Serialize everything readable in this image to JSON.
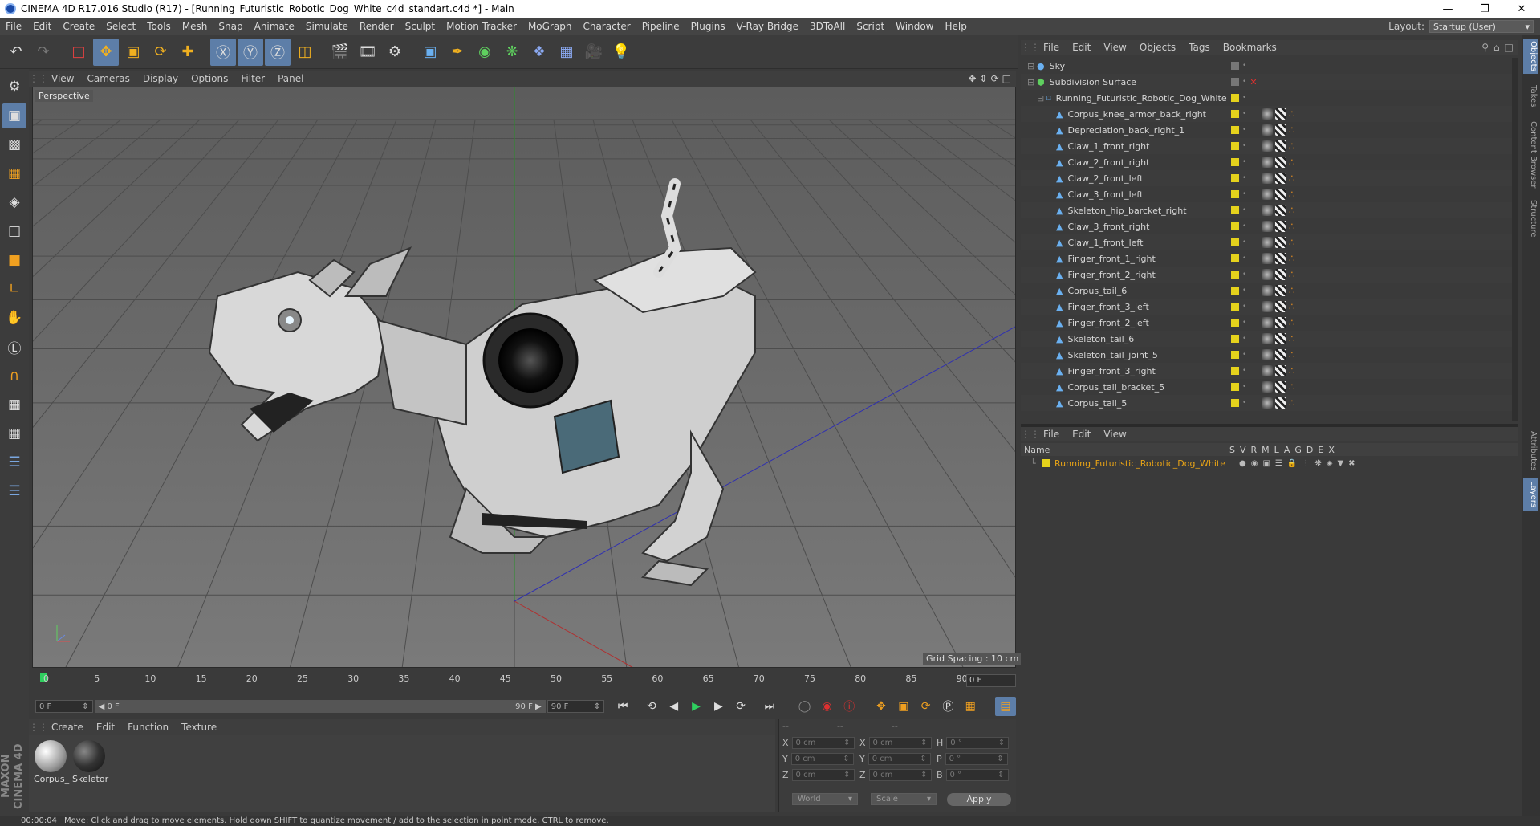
{
  "title": "CINEMA 4D R17.016 Studio (R17) - [Running_Futuristic_Robotic_Dog_White_c4d_standart.c4d *] - Main",
  "menu": [
    "File",
    "Edit",
    "Create",
    "Select",
    "Tools",
    "Mesh",
    "Snap",
    "Animate",
    "Simulate",
    "Render",
    "Sculpt",
    "Motion Tracker",
    "MoGraph",
    "Character",
    "Pipeline",
    "Plugins",
    "V-Ray Bridge",
    "3DToAll",
    "Script",
    "Window",
    "Help"
  ],
  "layout_label": "Layout:",
  "layout_value": "Startup (User)",
  "viewport_menu": [
    "View",
    "Cameras",
    "Display",
    "Options",
    "Filter",
    "Panel"
  ],
  "viewport_label": "Perspective",
  "grid_spacing": "Grid Spacing : 10 cm",
  "timeline_ticks": [
    "0",
    "5",
    "10",
    "15",
    "20",
    "25",
    "30",
    "35",
    "40",
    "45",
    "50",
    "55",
    "60",
    "65",
    "70",
    "75",
    "80",
    "85",
    "90"
  ],
  "current_frame": "0 F",
  "transport": {
    "start": "0 F",
    "slider_start": "0 F",
    "slider_end": "90 F",
    "end": "90 F"
  },
  "material_menu": [
    "Create",
    "Edit",
    "Function",
    "Texture"
  ],
  "materials": [
    {
      "name": "Corpus_"
    },
    {
      "name": "Skeletor"
    }
  ],
  "coords": {
    "header": [
      "--",
      "--",
      "--"
    ],
    "rows": [
      {
        "a": "X",
        "av": "0 cm",
        "b": "X",
        "bv": "0 cm",
        "c": "H",
        "cv": "0 °"
      },
      {
        "a": "Y",
        "av": "0 cm",
        "b": "Y",
        "bv": "0 cm",
        "c": "P",
        "cv": "0 °"
      },
      {
        "a": "Z",
        "av": "0 cm",
        "b": "Z",
        "bv": "0 cm",
        "c": "B",
        "cv": "0 °"
      }
    ],
    "world": "World",
    "scale": "Scale",
    "apply": "Apply"
  },
  "status": {
    "time": "00:00:04",
    "message": "Move: Click and drag to move elements. Hold down SHIFT to quantize movement / add to the selection in point mode, CTRL to remove."
  },
  "maxon": "MAXON CINEMA 4D",
  "object_menu": [
    "File",
    "Edit",
    "View",
    "Objects",
    "Tags",
    "Bookmarks"
  ],
  "objects": [
    {
      "name": "Sky",
      "indent": 0
    },
    {
      "name": "Subdivision Surface",
      "indent": 0
    },
    {
      "name": "Running_Futuristic_Robotic_Dog_White",
      "indent": 1
    },
    {
      "name": "Corpus_knee_armor_back_right",
      "indent": 2
    },
    {
      "name": "Depreciation_back_right_1",
      "indent": 2
    },
    {
      "name": "Claw_1_front_right",
      "indent": 2
    },
    {
      "name": "Claw_2_front_right",
      "indent": 2
    },
    {
      "name": "Claw_2_front_left",
      "indent": 2
    },
    {
      "name": "Claw_3_front_left",
      "indent": 2
    },
    {
      "name": "Skeleton_hip_barcket_right",
      "indent": 2
    },
    {
      "name": "Claw_3_front_right",
      "indent": 2
    },
    {
      "name": "Claw_1_front_left",
      "indent": 2
    },
    {
      "name": "Finger_front_1_right",
      "indent": 2
    },
    {
      "name": "Finger_front_2_right",
      "indent": 2
    },
    {
      "name": "Corpus_tail_6",
      "indent": 2
    },
    {
      "name": "Finger_front_3_left",
      "indent": 2
    },
    {
      "name": "Finger_front_2_left",
      "indent": 2
    },
    {
      "name": "Skeleton_tail_6",
      "indent": 2
    },
    {
      "name": "Skeleton_tail_joint_5",
      "indent": 2
    },
    {
      "name": "Finger_front_3_right",
      "indent": 2
    },
    {
      "name": "Corpus_tail_bracket_5",
      "indent": 2
    },
    {
      "name": "Corpus_tail_5",
      "indent": 2
    }
  ],
  "layer_menu": [
    "File",
    "Edit",
    "View"
  ],
  "layer_header": {
    "name": "Name",
    "cols": [
      "S",
      "V",
      "R",
      "M",
      "L",
      "A",
      "G",
      "D",
      "E",
      "X"
    ]
  },
  "layer_row": "Running_Futuristic_Robotic_Dog_White",
  "right_tabs": [
    "Objects",
    "Takes",
    "Content Browser",
    "Structure"
  ],
  "right_tabs_lower": [
    "Attributes",
    "Layers"
  ],
  "colors": {
    "accent": "#5d7ea8",
    "layer_color": "#e5d21c",
    "layer_text": "#e8a316"
  }
}
